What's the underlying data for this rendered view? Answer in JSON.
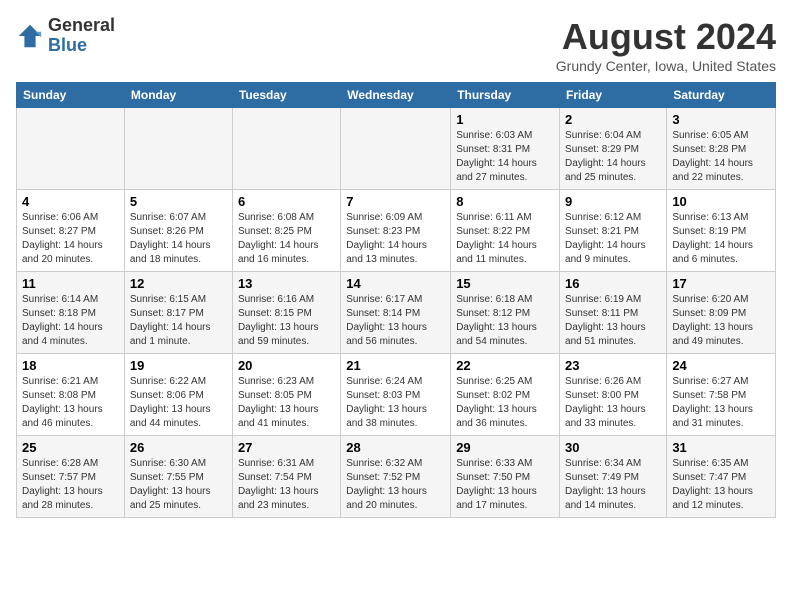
{
  "logo": {
    "general": "General",
    "blue": "Blue"
  },
  "title": "August 2024",
  "location": "Grundy Center, Iowa, United States",
  "days_of_week": [
    "Sunday",
    "Monday",
    "Tuesday",
    "Wednesday",
    "Thursday",
    "Friday",
    "Saturday"
  ],
  "weeks": [
    [
      {
        "day": "",
        "info": ""
      },
      {
        "day": "",
        "info": ""
      },
      {
        "day": "",
        "info": ""
      },
      {
        "day": "",
        "info": ""
      },
      {
        "day": "1",
        "info": "Sunrise: 6:03 AM\nSunset: 8:31 PM\nDaylight: 14 hours and 27 minutes."
      },
      {
        "day": "2",
        "info": "Sunrise: 6:04 AM\nSunset: 8:29 PM\nDaylight: 14 hours and 25 minutes."
      },
      {
        "day": "3",
        "info": "Sunrise: 6:05 AM\nSunset: 8:28 PM\nDaylight: 14 hours and 22 minutes."
      }
    ],
    [
      {
        "day": "4",
        "info": "Sunrise: 6:06 AM\nSunset: 8:27 PM\nDaylight: 14 hours and 20 minutes."
      },
      {
        "day": "5",
        "info": "Sunrise: 6:07 AM\nSunset: 8:26 PM\nDaylight: 14 hours and 18 minutes."
      },
      {
        "day": "6",
        "info": "Sunrise: 6:08 AM\nSunset: 8:25 PM\nDaylight: 14 hours and 16 minutes."
      },
      {
        "day": "7",
        "info": "Sunrise: 6:09 AM\nSunset: 8:23 PM\nDaylight: 14 hours and 13 minutes."
      },
      {
        "day": "8",
        "info": "Sunrise: 6:11 AM\nSunset: 8:22 PM\nDaylight: 14 hours and 11 minutes."
      },
      {
        "day": "9",
        "info": "Sunrise: 6:12 AM\nSunset: 8:21 PM\nDaylight: 14 hours and 9 minutes."
      },
      {
        "day": "10",
        "info": "Sunrise: 6:13 AM\nSunset: 8:19 PM\nDaylight: 14 hours and 6 minutes."
      }
    ],
    [
      {
        "day": "11",
        "info": "Sunrise: 6:14 AM\nSunset: 8:18 PM\nDaylight: 14 hours and 4 minutes."
      },
      {
        "day": "12",
        "info": "Sunrise: 6:15 AM\nSunset: 8:17 PM\nDaylight: 14 hours and 1 minute."
      },
      {
        "day": "13",
        "info": "Sunrise: 6:16 AM\nSunset: 8:15 PM\nDaylight: 13 hours and 59 minutes."
      },
      {
        "day": "14",
        "info": "Sunrise: 6:17 AM\nSunset: 8:14 PM\nDaylight: 13 hours and 56 minutes."
      },
      {
        "day": "15",
        "info": "Sunrise: 6:18 AM\nSunset: 8:12 PM\nDaylight: 13 hours and 54 minutes."
      },
      {
        "day": "16",
        "info": "Sunrise: 6:19 AM\nSunset: 8:11 PM\nDaylight: 13 hours and 51 minutes."
      },
      {
        "day": "17",
        "info": "Sunrise: 6:20 AM\nSunset: 8:09 PM\nDaylight: 13 hours and 49 minutes."
      }
    ],
    [
      {
        "day": "18",
        "info": "Sunrise: 6:21 AM\nSunset: 8:08 PM\nDaylight: 13 hours and 46 minutes."
      },
      {
        "day": "19",
        "info": "Sunrise: 6:22 AM\nSunset: 8:06 PM\nDaylight: 13 hours and 44 minutes."
      },
      {
        "day": "20",
        "info": "Sunrise: 6:23 AM\nSunset: 8:05 PM\nDaylight: 13 hours and 41 minutes."
      },
      {
        "day": "21",
        "info": "Sunrise: 6:24 AM\nSunset: 8:03 PM\nDaylight: 13 hours and 38 minutes."
      },
      {
        "day": "22",
        "info": "Sunrise: 6:25 AM\nSunset: 8:02 PM\nDaylight: 13 hours and 36 minutes."
      },
      {
        "day": "23",
        "info": "Sunrise: 6:26 AM\nSunset: 8:00 PM\nDaylight: 13 hours and 33 minutes."
      },
      {
        "day": "24",
        "info": "Sunrise: 6:27 AM\nSunset: 7:58 PM\nDaylight: 13 hours and 31 minutes."
      }
    ],
    [
      {
        "day": "25",
        "info": "Sunrise: 6:28 AM\nSunset: 7:57 PM\nDaylight: 13 hours and 28 minutes."
      },
      {
        "day": "26",
        "info": "Sunrise: 6:30 AM\nSunset: 7:55 PM\nDaylight: 13 hours and 25 minutes."
      },
      {
        "day": "27",
        "info": "Sunrise: 6:31 AM\nSunset: 7:54 PM\nDaylight: 13 hours and 23 minutes."
      },
      {
        "day": "28",
        "info": "Sunrise: 6:32 AM\nSunset: 7:52 PM\nDaylight: 13 hours and 20 minutes."
      },
      {
        "day": "29",
        "info": "Sunrise: 6:33 AM\nSunset: 7:50 PM\nDaylight: 13 hours and 17 minutes."
      },
      {
        "day": "30",
        "info": "Sunrise: 6:34 AM\nSunset: 7:49 PM\nDaylight: 13 hours and 14 minutes."
      },
      {
        "day": "31",
        "info": "Sunrise: 6:35 AM\nSunset: 7:47 PM\nDaylight: 13 hours and 12 minutes."
      }
    ]
  ]
}
